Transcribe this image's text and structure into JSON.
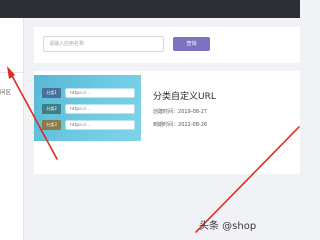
{
  "sidebar": {
    "partial_text": "问区"
  },
  "search": {
    "placeholder": "请输入应用名称",
    "button_label": "查询"
  },
  "card": {
    "title": "分类自定义URL",
    "created_label": "创建时间：",
    "created_date": "2019-08-27",
    "expire_label": "到期时间：",
    "expire_date": "2022-08-26",
    "links": [
      {
        "label": "分类1",
        "value": "https://...",
        "color": "#4a6f9a"
      },
      {
        "label": "分类2",
        "value": "https://...",
        "color": "#3e7f83"
      },
      {
        "label": "分类3",
        "value": "https://...",
        "color": "#8a7a4c"
      }
    ]
  },
  "watermark": {
    "text": "头条 @shop"
  },
  "colors": {
    "top_bar": "#2e2f36",
    "button": "#7b73c1",
    "arrow": "#e0291f"
  }
}
